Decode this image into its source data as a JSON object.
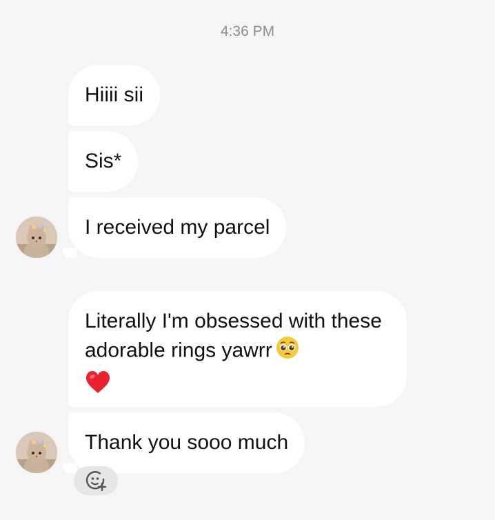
{
  "timestamp": "4:36 PM",
  "messages": [
    {
      "text": "Hiiii sii"
    },
    {
      "text": "Sis*"
    },
    {
      "text": "I received my parcel"
    },
    {
      "text": "Literally I'm obsessed with these adorable rings yawrr",
      "emoji": "pleading-face-emoji",
      "trailing_emoji": "red-heart-emoji"
    },
    {
      "text": "Thank you sooo much"
    }
  ],
  "avatar": {
    "icon": "cat-avatar"
  },
  "reaction_button": {
    "icon": "add-reaction-icon"
  },
  "colors": {
    "background": "#f5f5f5",
    "bubble": "#ffffff",
    "timestamp": "#8e8e8e",
    "text": "#111111"
  }
}
